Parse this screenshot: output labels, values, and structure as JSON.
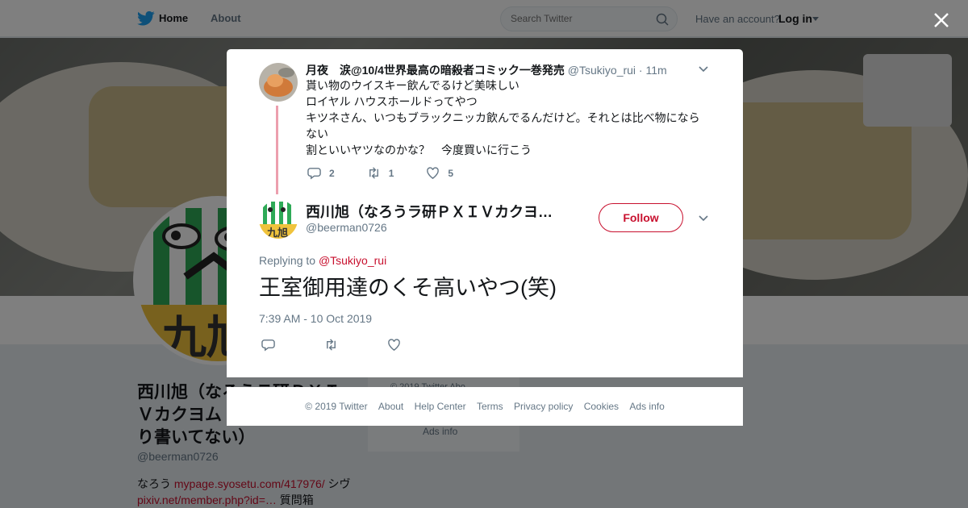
{
  "nav": {
    "home_label": "Home",
    "about_label": "About",
    "search_placeholder": "Search Twitter",
    "have_account": "Have an account?",
    "login_label": "Log in",
    "brand_color": "#1da1f2"
  },
  "background_profile": {
    "name": "西川旭（なろうラ研ＰＸＩＶカクヨムり書いてない）",
    "name_lines": [
      "西川旭（なろうラ研ＰＸＩ",
      "Ｖカクヨム",
      "り書いてない）"
    ],
    "handle": "@beerman0726",
    "bio_prefix": "なろう ",
    "bio_link1": "mypage.syosetu.com/417976/",
    "bio_mid": " シヴ ",
    "bio_link2": "pixiv.net/member.php?id=…",
    "bio_suffix": " 質問箱",
    "side_copy": "© 2019 Twitter  Abo",
    "side_ads": "Ads info"
  },
  "parent_tweet": {
    "name": "月夜　涙@10/4世界最高の暗殺者コミック一巻発売",
    "handle": "@Tsukiyo_rui",
    "separator": " · ",
    "time": "11m",
    "lines": [
      "貰い物のウイスキー飲んでるけど美味しい",
      "ロイヤル ハウスホールドってやつ",
      "キツネさん、いつもブラックニッカ飲んでるんだけど。それとは比べ物にならない",
      "割といいヤツなのかな？　今度買いに行こう"
    ],
    "replies": "2",
    "retweets": "1",
    "likes": "5"
  },
  "main_tweet": {
    "name": "西川旭（なろうラ研ＰＸＩＶカクヨ…",
    "handle": "@beerman0726",
    "follow_label": "Follow",
    "replying_prefix": "Replying to ",
    "replying_to": "@Tsukiyo_rui",
    "text": "王室御用達のくそ高いやつ(笑)",
    "timestamp": "7:39 AM - 10 Oct 2019",
    "accent_color": "#c8102e"
  },
  "footer": {
    "links": [
      "© 2019 Twitter",
      "About",
      "Help Center",
      "Terms",
      "Privacy policy",
      "Cookies",
      "Ads info"
    ]
  }
}
